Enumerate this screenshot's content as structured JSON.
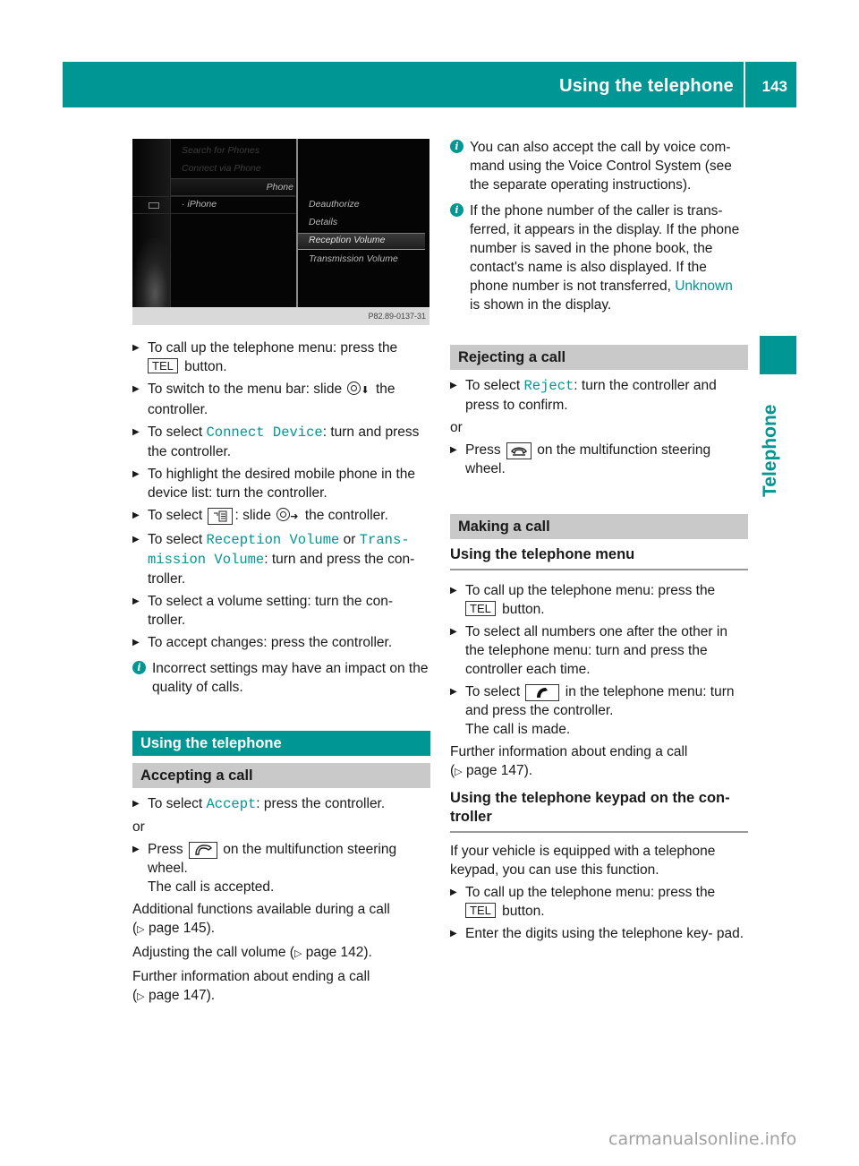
{
  "header": {
    "title": "Using the telephone",
    "page_number": "143"
  },
  "side_tab": {
    "label": "Telephone"
  },
  "colors": {
    "accent": "#009694",
    "heading_gray": "#c9c9c9"
  },
  "screenshot": {
    "menu_items_left": [
      "Search for Phones",
      "Connect via Phone"
    ],
    "section_label": "Phone",
    "device": "iPhone",
    "menu_items_right": [
      "Deauthorize",
      "Details",
      "Reception Volume",
      "Transmission Volume"
    ],
    "selected_item": "Reception Volume",
    "caption": "P82.89-0137-31"
  },
  "left": {
    "steps": [
      {
        "pre": "To call up the telephone menu: press the",
        "key": "TEL",
        "post": "button."
      },
      {
        "pre": "To switch to the menu bar: slide",
        "post": "the controller."
      },
      {
        "pre": "To select",
        "code": "Connect Device",
        "post": ": turn and press the controller."
      },
      {
        "text": "To highlight the desired mobile phone in the device list: turn the controller."
      },
      {
        "pre": "To select",
        "post": ": slide",
        "post2": "the controller."
      },
      {
        "pre": "To select",
        "code": "Reception Volume",
        "mid": "or",
        "code2": "Trans- mission Volume",
        "post": ": turn and press the con- troller."
      },
      {
        "text": "To select a volume setting: turn the con- troller."
      },
      {
        "text": "To accept changes: press the controller."
      }
    ],
    "note": "Incorrect settings may have an impact on the quality of calls.",
    "section_title": "Using the telephone",
    "accepting": {
      "title": "Accepting a call",
      "step1_pre": "To select",
      "step1_code": "Accept",
      "step1_post": ": press the controller.",
      "or": "or",
      "step2_pre": "Press",
      "step2_post": "on the multifunction steering wheel.",
      "step2_result": "The call is accepted.",
      "para1": "Additional functions available during a call",
      "para1_ref": "page 145",
      "para2": "Adjusting the call volume",
      "para2_ref": "page 142",
      "para3": "Further information about ending a call",
      "para3_ref": "page 147"
    }
  },
  "right": {
    "note1": "You can also accept the call by voice com- mand using the Voice Control System (see the separate operating instructions).",
    "note2_pre": "If the phone number of the caller is trans- ferred, it appears in the display. If the phone number is saved in the phone book, the contact's name is also displayed. If the phone number is not transferred,",
    "note2_code": "Unknown",
    "note2_post": "is shown in the display.",
    "rejecting": {
      "title": "Rejecting a call",
      "step1_pre": "To select",
      "step1_code": "Reject",
      "step1_post": ": turn the controller and press to confirm.",
      "or": "or",
      "step2_pre": "Press",
      "step2_post": "on the multifunction steering wheel."
    },
    "making": {
      "title": "Making a call",
      "subtitle": "Using the telephone menu",
      "step1_pre": "To call up the telephone menu: press the",
      "step1_key": "TEL",
      "step1_post": "button.",
      "step2": "To select all numbers one after the other in the telephone menu: turn and press the controller each time.",
      "step3_pre": "To select",
      "step3_post": "in the telephone menu: turn and press the controller.",
      "step3_result": "The call is made.",
      "para": "Further information about ending a call",
      "para_ref": "page 147"
    },
    "keypad": {
      "title": "Using the telephone keypad on the con- troller",
      "intro": "If your vehicle is equipped with a telephone keypad, you can use this function.",
      "step1_pre": "To call up the telephone menu: press the",
      "step1_key": "TEL",
      "step1_post": "button.",
      "step2": "Enter the digits using the telephone key- pad."
    }
  },
  "watermark": "carmanualsonline.info"
}
